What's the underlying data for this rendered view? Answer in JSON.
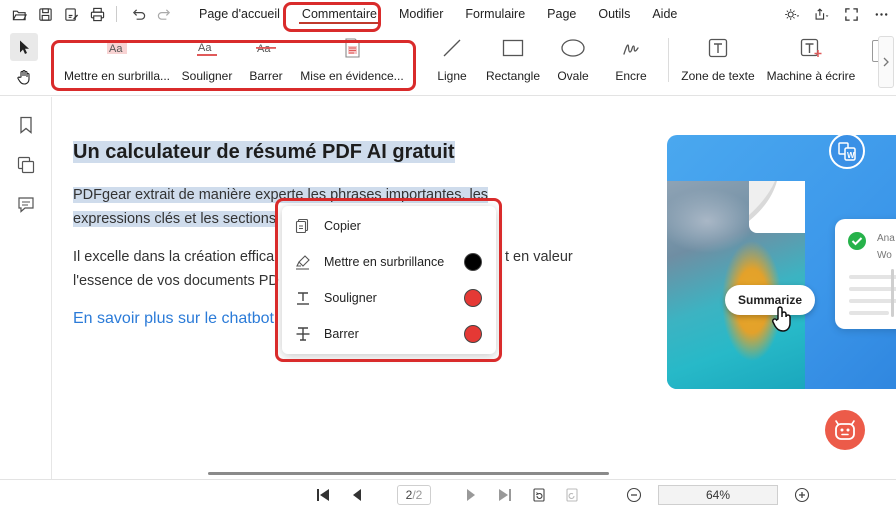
{
  "menu": {
    "items": [
      "Page d'accueil",
      "Commentaire",
      "Modifier",
      "Formulaire",
      "Page",
      "Outils",
      "Aide"
    ],
    "active_index": 1
  },
  "ribbon": {
    "highlight_tools": [
      {
        "label": "Mettre en surbrilla...",
        "icon": "highlight-text-icon"
      },
      {
        "label": "Souligner",
        "icon": "underline-text-icon"
      },
      {
        "label": "Barrer",
        "icon": "strikethrough-text-icon"
      },
      {
        "label": "Mise en évidence...",
        "icon": "area-highlight-icon"
      }
    ],
    "shape_tools": [
      {
        "label": "Ligne",
        "icon": "line-icon"
      },
      {
        "label": "Rectangle",
        "icon": "rectangle-icon"
      },
      {
        "label": "Ovale",
        "icon": "oval-icon"
      },
      {
        "label": "Encre",
        "icon": "ink-pen-icon"
      }
    ],
    "text_tools": [
      {
        "label": "Zone de texte",
        "icon": "textbox-icon"
      },
      {
        "label": "Machine à écrire",
        "icon": "typewriter-icon"
      }
    ]
  },
  "document": {
    "title": "Un calculateur de résumé PDF AI gratuit",
    "paragraph1": {
      "line1": "PDFgear extrait de manière experte les phrases importantes, les",
      "line2": "expressions clés et les sections"
    },
    "paragraph2": {
      "line1": "Il excelle dans la création effica",
      "line1_end": "t en valeur",
      "line2": "l'essence de vos documents PD"
    },
    "link": "En savoir plus sur le chatbot",
    "promo": {
      "card_text_1": "Ana",
      "card_text_2": "Wo",
      "button": "Summarize"
    }
  },
  "context_menu": {
    "items": [
      {
        "label": "Copier",
        "icon": "copy-icon"
      },
      {
        "label": "Mettre en surbrillance",
        "icon": "highlighter-icon",
        "color": "#000000"
      },
      {
        "label": "Souligner",
        "icon": "underline-icon",
        "color": "#e53935"
      },
      {
        "label": "Barrer",
        "icon": "strikethrough-icon",
        "color": "#e53935"
      }
    ]
  },
  "statusbar": {
    "page_current": "2",
    "page_total": "/2",
    "zoom": "64%"
  },
  "colors": {
    "accent_red": "#d92b2b",
    "selection": "#cfdcec",
    "link": "#2b7bd8",
    "chatbot": "#ec5b49"
  }
}
